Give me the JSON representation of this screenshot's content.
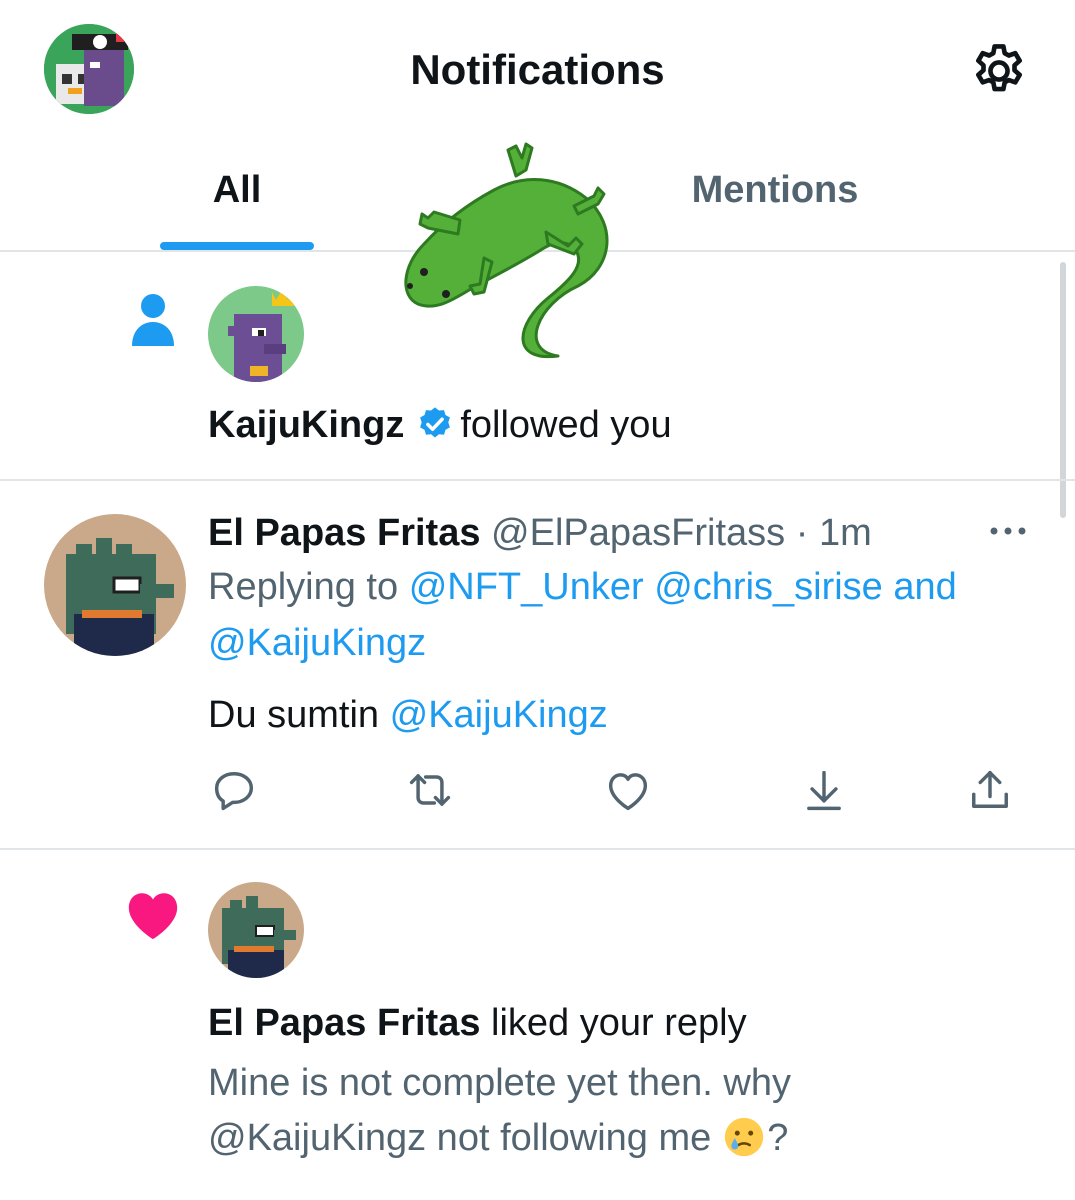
{
  "header": {
    "title": "Notifications"
  },
  "tabs": [
    {
      "label": "All",
      "active": true
    },
    {
      "label": "Mentions",
      "active": false
    }
  ],
  "notifications": [
    {
      "type": "follow",
      "icon": "person-icon",
      "user": "KaijuKingz",
      "verified": true,
      "action_text": "followed you"
    },
    {
      "type": "reply",
      "display_name": "El Papas Fritas",
      "handle": "@ElPapasFritass",
      "separator": "·",
      "time": "1m",
      "replying_prefix": "Replying to",
      "reply_to_1": "@NFT_Unker",
      "reply_to_2": "@chris_sirise",
      "reply_to_and": "and",
      "reply_to_3": "@KaijuKingz",
      "body_text": "Du sumtin",
      "body_mention": "@KaijuKingz",
      "actions": [
        "reply-icon",
        "retweet-icon",
        "like-icon",
        "bookmark-icon",
        "share-icon"
      ]
    },
    {
      "type": "like",
      "icon": "heart-icon",
      "display_name": "El Papas Fritas",
      "action_text": "liked your reply",
      "quote_line1": "Mine is not complete yet then. why",
      "quote_line2": "@KaijuKingz not following me",
      "quote_suffix": "?"
    }
  ],
  "colors": {
    "accent": "#1d9bf0",
    "text": "#0f1419",
    "secondary": "#536471",
    "like": "#f91880",
    "divider": "#e1e5e8"
  }
}
